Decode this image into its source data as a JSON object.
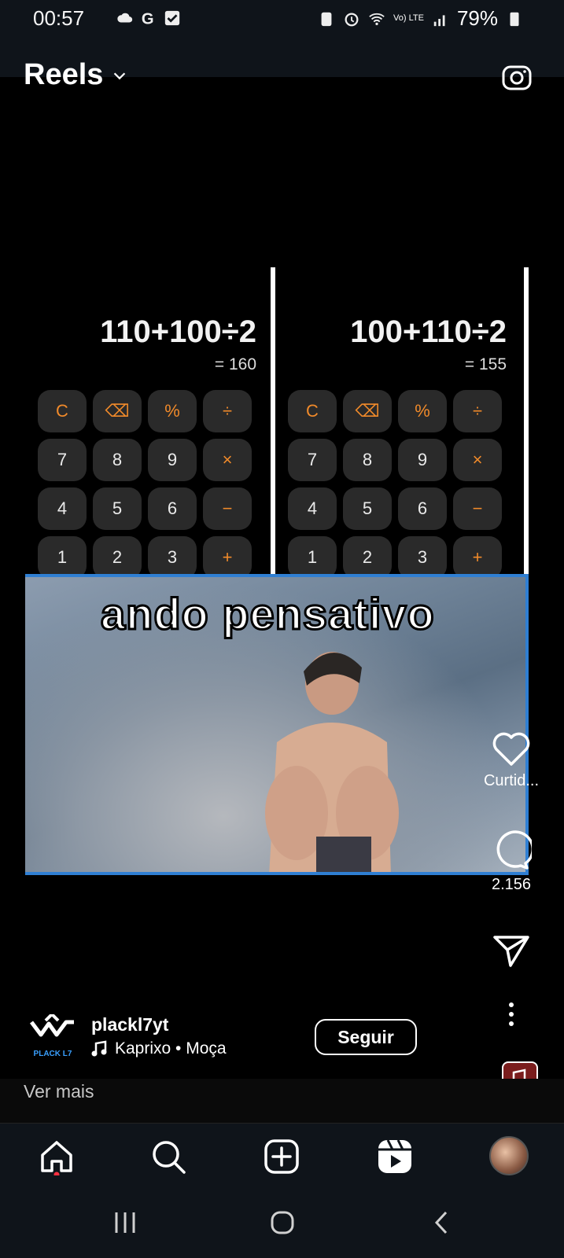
{
  "status": {
    "time": "00:57",
    "battery": "79%",
    "network": "Vo) LTE"
  },
  "header": {
    "title": "Reels"
  },
  "video": {
    "left_calc": {
      "expression": "110+100÷2",
      "result": "= 160"
    },
    "right_calc": {
      "expression": "100+110÷2",
      "result": "= 155"
    },
    "keys": [
      "C",
      "⌫",
      "%",
      "÷",
      "7",
      "8",
      "9",
      "×",
      "4",
      "5",
      "6",
      "−",
      "1",
      "2",
      "3",
      "+"
    ],
    "meme_caption": "ando pensativo"
  },
  "rail": {
    "likes_label": "Curtid...",
    "comments_count": "2.156"
  },
  "author": {
    "logo_text": "PLACK L7",
    "username": "plackl7yt",
    "music": "Kaprixo • Moça",
    "follow_label": "Seguir"
  },
  "caption": {
    "more_label": "Ver mais"
  },
  "colors": {
    "accent": "#2f7fd3",
    "calc_op": "#f08a2a",
    "notification": "#ff3040"
  }
}
